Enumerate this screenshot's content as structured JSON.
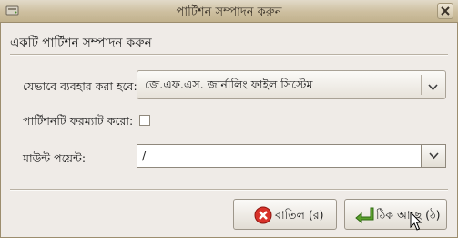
{
  "window": {
    "title": "পার্টিশন সম্পাদন করুন"
  },
  "dialog": {
    "heading": "একটি পার্টিশন সম্পাদন করুন",
    "use_as": {
      "label": "যেভাবে ব্যবহার করা হবে:",
      "value": "জে.এফ.এস. জার্নালিং ফাইল সিস্টেম"
    },
    "format": {
      "label": "পার্টিশনটি ফরম্যাট করো:",
      "checked": false
    },
    "mount_point": {
      "label": "মাউন্ট পয়েন্ট:",
      "value": "/"
    },
    "buttons": {
      "cancel": "বাতিল (র)",
      "ok": "ঠিক আছে (ঠ)"
    }
  },
  "colors": {
    "title_bar": "#cdbf9f",
    "cancel_icon": "#d8322a",
    "ok_icon": "#5aa02c",
    "dialog_bg": "#efebe7"
  },
  "icons": {
    "window": "drive-icon",
    "close": "close-icon",
    "cancel": "cancel-icon",
    "ok": "enter-arrow-icon"
  }
}
